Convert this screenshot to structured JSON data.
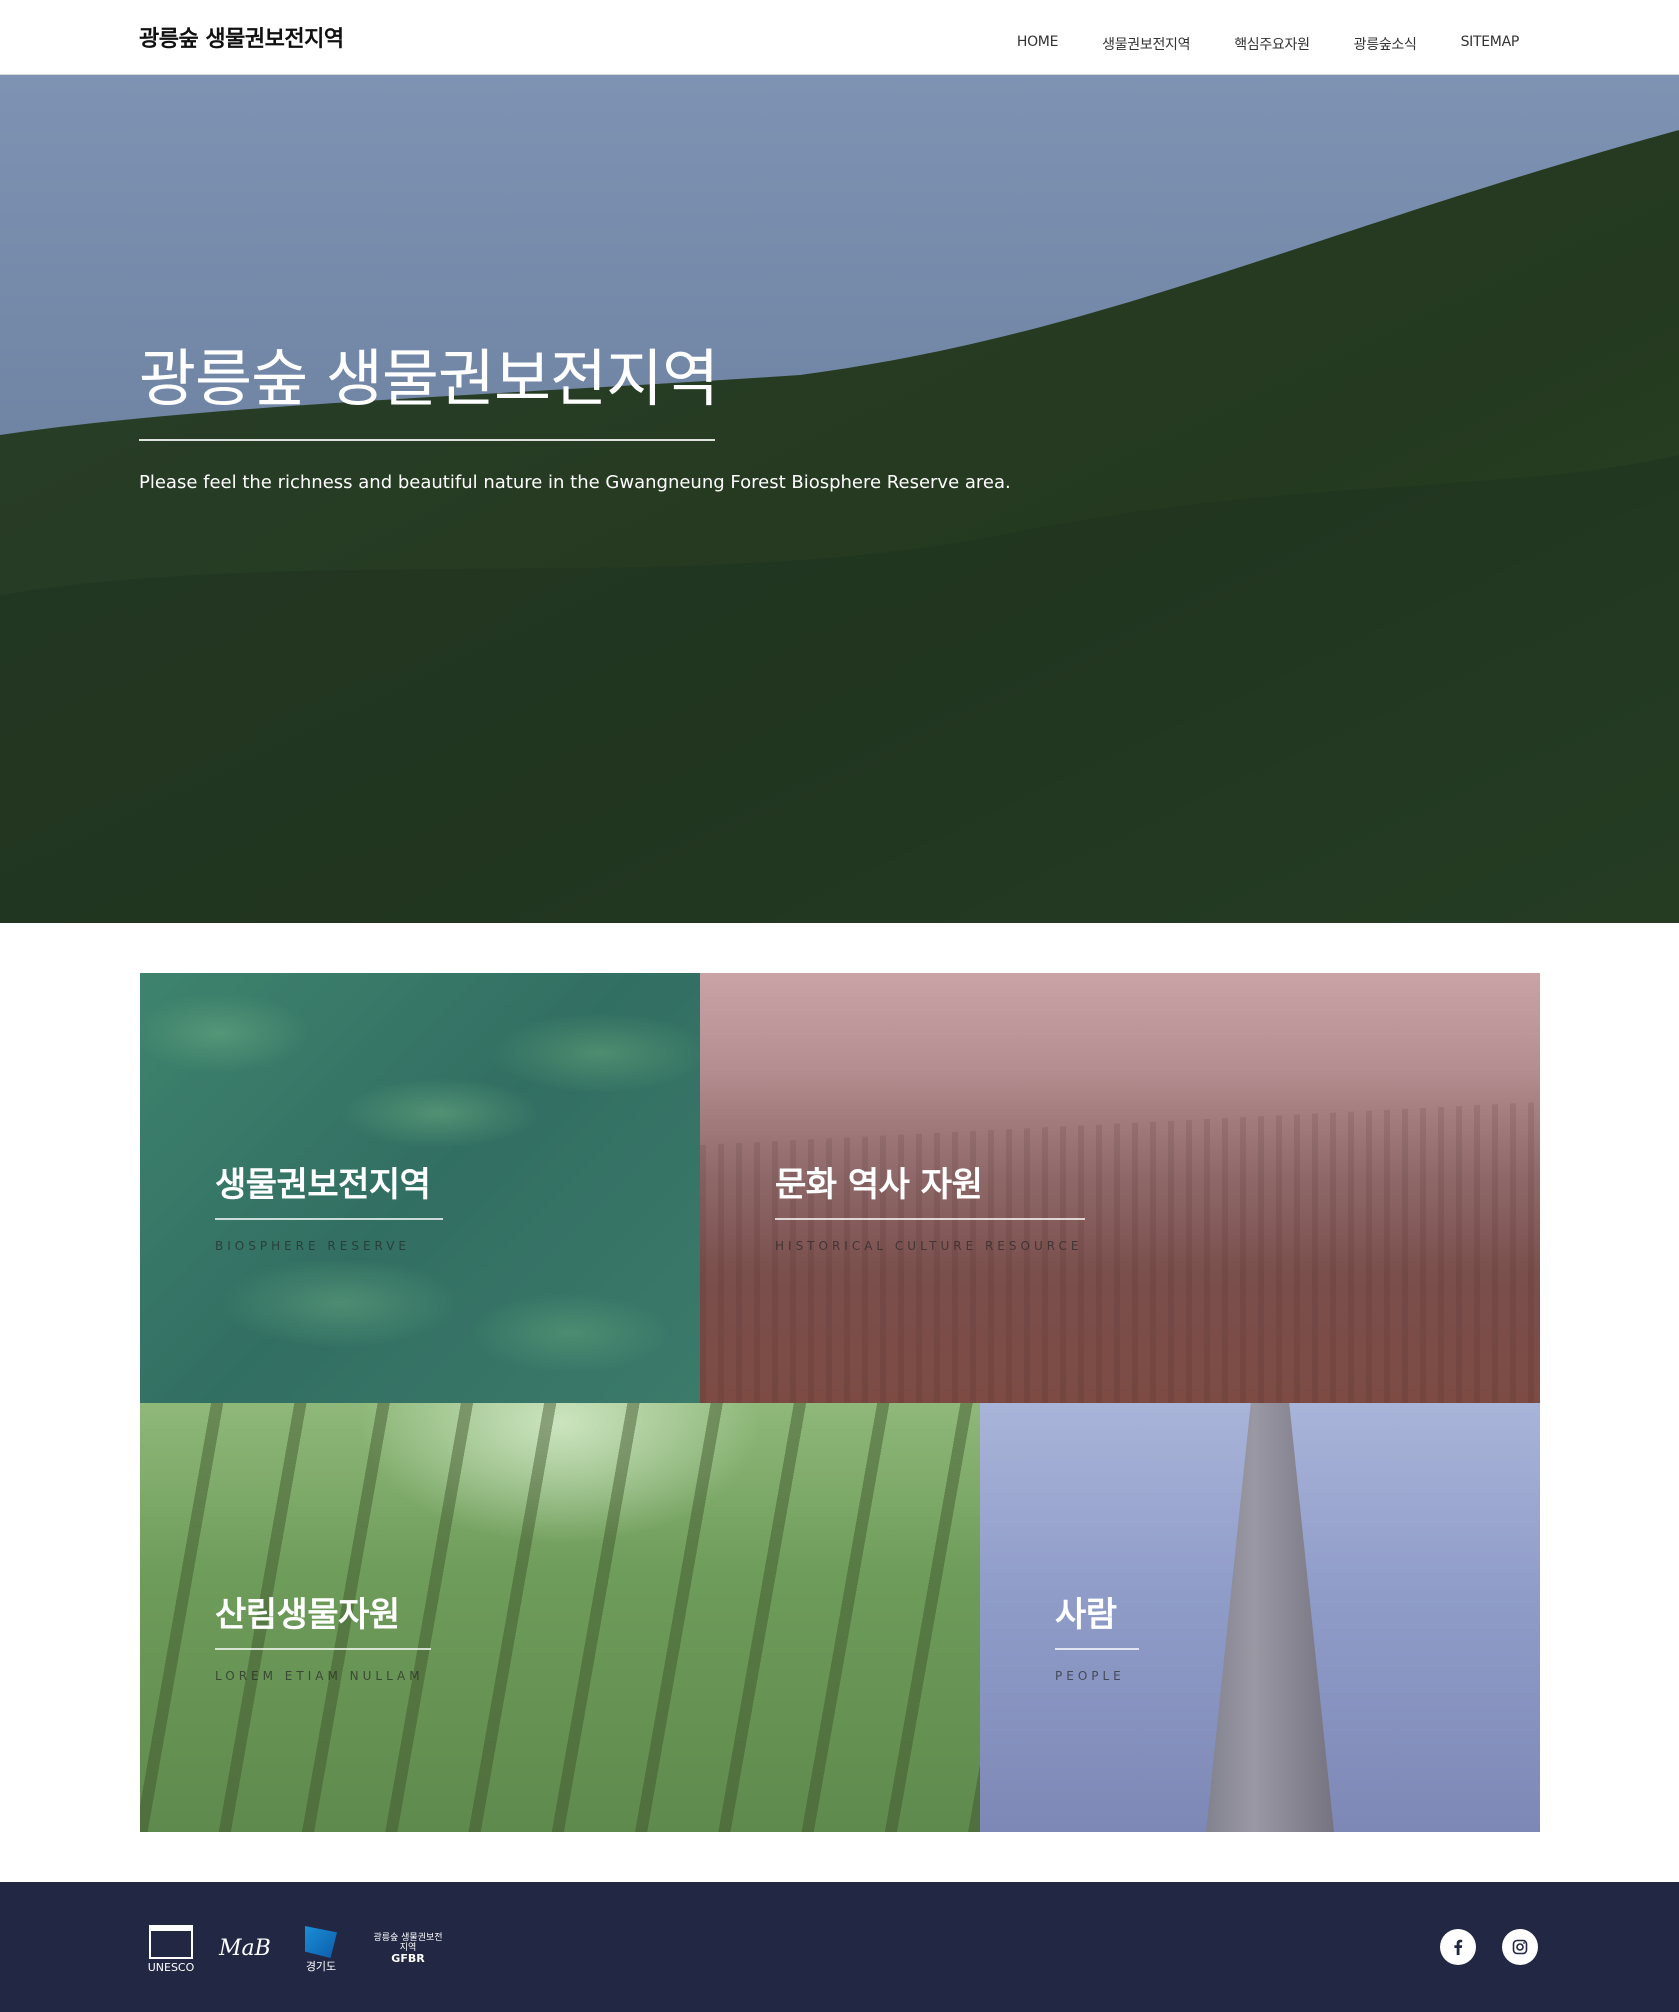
{
  "header": {
    "logo": "광릉숲 생물권보전지역",
    "nav": [
      "HOME",
      "생물권보전지역",
      "핵심주요자원",
      "광릉숲소식",
      "SITEMAP"
    ]
  },
  "hero": {
    "title": "광릉숲 생물권보전지역",
    "subtitle": "Please feel the richness and beautiful nature in the Gwangneung Forest Biosphere Reserve area."
  },
  "tiles": [
    {
      "title": "생물권보전지역",
      "subtitle": "BIOSPHERE RESERVE"
    },
    {
      "title": "문화 역사 자원",
      "subtitle": "HISTORICAL CULTURE RESOURCE"
    },
    {
      "title": "산림생물자원",
      "subtitle": "LOREM ETIAM NULLAM"
    },
    {
      "title": "사람",
      "subtitle": "PEOPLE"
    }
  ],
  "footer": {
    "logos": {
      "unesco": "UNESCO",
      "mab": "MaB",
      "gyeonggi": "경기도",
      "gfbr_name": "광릉숲 생물권보전지역",
      "gfbr": "GFBR"
    },
    "social": [
      "facebook-icon",
      "instagram-icon"
    ]
  },
  "colors": {
    "footer_bg": "#222743",
    "tile_green": "#3c7f62",
    "tile_rose": "#9a6f70",
    "tile_forest": "#6e9c5a",
    "tile_lavender": "#8f9cc8"
  }
}
